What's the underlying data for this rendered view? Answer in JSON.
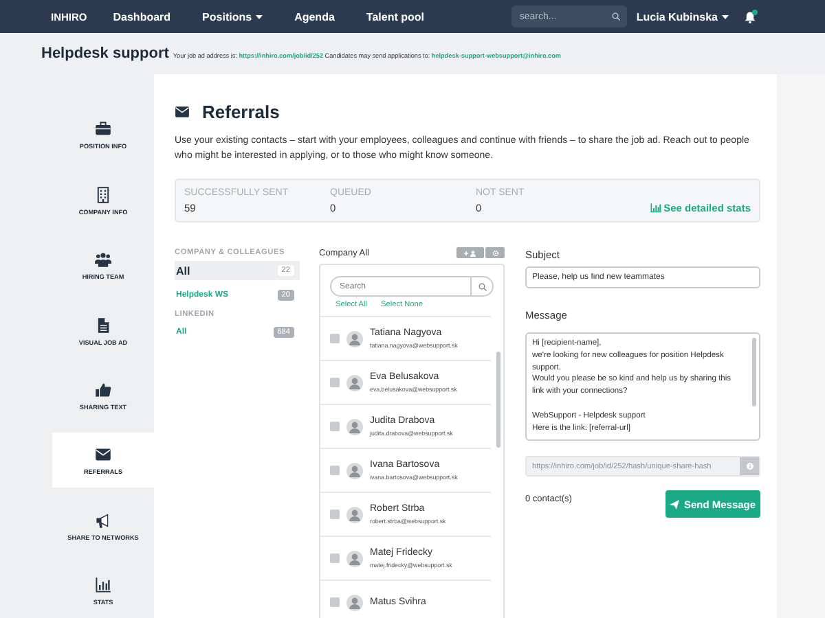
{
  "nav": {
    "logo": "INHIRO",
    "links": [
      {
        "label": "Dashboard",
        "dropdown": false
      },
      {
        "label": "Positions",
        "dropdown": true
      },
      {
        "label": "Agenda",
        "dropdown": false
      },
      {
        "label": "Talent pool",
        "dropdown": false
      }
    ],
    "search": {
      "placeholder": "search..."
    },
    "user": "Lucia Kubinska",
    "notification": true
  },
  "header": {
    "title": "Helpdesk support",
    "address_label": "Your job ad address is:",
    "address_url": "https://inhiro.com/job/id/252",
    "applications_label": "Candidates may send applications to:",
    "applications_email": "helpdesk-support-websupport@inhiro.com"
  },
  "sidebar": {
    "items": [
      {
        "label": "POSITION INFO",
        "selected": false
      },
      {
        "label": "COMPANY INFO",
        "selected": false
      },
      {
        "label": "HIRING TEAM",
        "selected": false
      },
      {
        "label": "VISUAL JOB AD",
        "selected": false
      },
      {
        "label": "SHARING TEXT",
        "selected": false
      },
      {
        "label": "REFERRALS",
        "selected": true
      },
      {
        "label": "SHARE TO NETWORKS",
        "selected": false
      },
      {
        "label": "STATS",
        "selected": false
      }
    ]
  },
  "referrals": {
    "title": "Referrals",
    "description": "Use your existing contacts – start with your employees, colleagues and continue with friends – to share the job ad. Reach out to people who might be interested in applying, or to those who might know someone.",
    "stats": [
      {
        "label": "SUCCESSFULLY SENT",
        "value": "59"
      },
      {
        "label": "QUEUED",
        "value": "0"
      },
      {
        "label": "NOT SENT",
        "value": "0"
      }
    ],
    "stats_link": "See detailed stats",
    "groups": [
      {
        "heading": "COMPANY & COLLEAGUES",
        "items": [
          {
            "label": "All",
            "count": "22",
            "selected": true
          },
          {
            "label": "Helpdesk WS",
            "count": "20",
            "selected": false
          }
        ]
      },
      {
        "heading": "LINKEDIN",
        "items": [
          {
            "label": "All",
            "count": "684",
            "selected": false
          }
        ]
      }
    ],
    "contacts": {
      "title": "Company All",
      "search": {
        "placeholder": "Search"
      },
      "select_all": "Select All",
      "select_none": "Select None",
      "items": [
        {
          "name": "Tatiana Nagyova",
          "email": "tatiana.nagyova@websupport.sk",
          "checked": false
        },
        {
          "name": "Eva Belusakova",
          "email": "eva.belusakova@websupport.sk",
          "checked": false
        },
        {
          "name": "Judita Drabova",
          "email": "judita.drabova@websupport.sk",
          "checked": false
        },
        {
          "name": "Ivana Bartosova",
          "email": "ivana.bartosova@websupport.sk",
          "checked": false
        },
        {
          "name": "Robert Strba",
          "email": "robert.strba@websupport.sk",
          "checked": false
        },
        {
          "name": "Matej Fridecky",
          "email": "matej.fridecky@websupport.sk",
          "checked": false
        },
        {
          "name": "Matus Svihra",
          "checked": false
        }
      ]
    },
    "message": {
      "subject_label": "Subject",
      "subject": "Please, help us find new teammates",
      "message_label": "Message",
      "message": "Hi [recipient-name],\nwe're looking for new colleagues for position Helpdesk support.\nWould you please be so kind and help us by sharing this link with your connections?\n\nWebSupport - Helpdesk support\nHere is the link: [referral-url]",
      "share_url": "https://inhiro.com/job/id/252/hash/unique-share-hash",
      "contacts_count": "0 contact(s)",
      "send_button": "Send Message"
    }
  }
}
